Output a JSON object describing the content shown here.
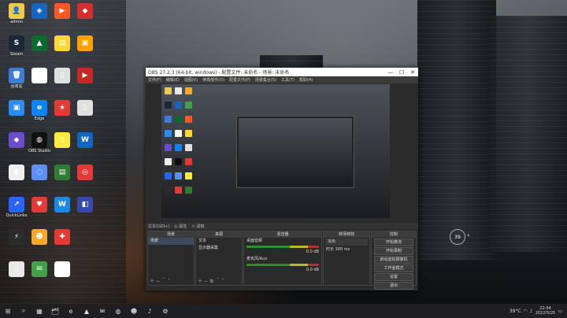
{
  "desktop": {
    "icons": [
      {
        "label": "admin",
        "color": "#f2c94c",
        "glyph": "👤"
      },
      {
        "label": "Steam",
        "color": "#1b2838",
        "glyph": "S"
      },
      {
        "label": "回收站",
        "color": "#3b7dd8",
        "glyph": "🗑"
      },
      {
        "label": "",
        "color": "#2d8cf0",
        "glyph": "▣"
      },
      {
        "label": "",
        "color": "#6a4ccf",
        "glyph": "◆"
      },
      {
        "label": "",
        "color": "#f0f0f0",
        "glyph": "▮"
      },
      {
        "label": "QuickLinks",
        "color": "#2962ff",
        "glyph": "↗"
      },
      {
        "label": "",
        "color": "#2b2b2b",
        "glyph": "⚡"
      },
      {
        "label": "",
        "color": "#e8e8e8",
        "glyph": "▯"
      },
      {
        "label": "",
        "color": "#1565c0",
        "glyph": "◈"
      },
      {
        "label": "",
        "color": "#0b6b2e",
        "glyph": "▲"
      },
      {
        "label": "",
        "color": "#fff",
        "glyph": "◉"
      },
      {
        "label": "Edge",
        "color": "#0a84ff",
        "glyph": "e"
      },
      {
        "label": "OBS Studio",
        "color": "#111",
        "glyph": "◍"
      },
      {
        "label": "",
        "color": "#5b8ff9",
        "glyph": "◌"
      },
      {
        "label": "",
        "color": "#e53935",
        "glyph": "♥"
      },
      {
        "label": "",
        "color": "#f9a825",
        "glyph": "☻"
      },
      {
        "label": "",
        "color": "#43a047",
        "glyph": "✉"
      },
      {
        "label": "",
        "color": "#ff5722",
        "glyph": "▶"
      },
      {
        "label": "",
        "color": "#fdd835",
        "glyph": "▤"
      },
      {
        "label": "",
        "color": "#e0e0e0",
        "glyph": "▯"
      },
      {
        "label": "",
        "color": "#e53935",
        "glyph": "★"
      },
      {
        "label": "",
        "color": "#ffeb3b",
        "glyph": "▯"
      },
      {
        "label": "",
        "color": "#2e7d32",
        "glyph": "▤"
      },
      {
        "label": "",
        "color": "#1e88e5",
        "glyph": "W"
      },
      {
        "label": "",
        "color": "#e53935",
        "glyph": "✚"
      },
      {
        "label": "",
        "color": "#fff",
        "glyph": "▭"
      },
      {
        "label": "",
        "color": "#d32f2f",
        "glyph": "◆"
      },
      {
        "label": "",
        "color": "#ffa000",
        "glyph": "▣"
      },
      {
        "label": "",
        "color": "#c62828",
        "glyph": "▶"
      },
      {
        "label": "",
        "color": "#e0e0e0",
        "glyph": "▯"
      },
      {
        "label": "",
        "color": "#1565c0",
        "glyph": "W"
      },
      {
        "label": "",
        "color": "#e53935",
        "glyph": "◎"
      },
      {
        "label": "",
        "color": "#3949ab",
        "glyph": "◧"
      }
    ]
  },
  "obs": {
    "title": "OBS 27.2.3 (64-bit, windows) - 配置文件: 未命名 - 场景: 未命名",
    "menu": [
      "文件(F)",
      "编辑(E)",
      "视图(V)",
      "停靠部件(D)",
      "配置文件(P)",
      "场景集合(S)",
      "工具(T)",
      "帮助(H)"
    ],
    "status_row": [
      "文本(GDI+)",
      "◎ 属性",
      "☼ 滤镜"
    ],
    "docks": {
      "scenes": {
        "title": "场景",
        "items": [
          "场景"
        ]
      },
      "sources": {
        "title": "来源",
        "items": [
          "文本",
          "显示器采集"
        ]
      },
      "mixer": {
        "title": "混音器",
        "items": [
          "桌面音频",
          "麦克风/Aux"
        ],
        "levels": [
          "0.0 dB",
          "0.0 dB"
        ]
      },
      "transitions": {
        "title": "转场特效",
        "items": [
          "淡出",
          "时长 300 ms"
        ]
      },
      "controls": {
        "title": "控制",
        "buttons": [
          "开始推流",
          "开始录制",
          "启动虚拟摄像机",
          "工作室模式",
          "设置",
          "退出"
        ]
      }
    }
  },
  "taskbar": {
    "start_glyph": "⊞",
    "search_glyph": "⌕",
    "apps": [
      "▦",
      "🗂",
      "e",
      "▲",
      "✉",
      "◍",
      "☻",
      "♪",
      "⚙"
    ],
    "tray": {
      "temp": "39°C",
      "time": "22:04",
      "date": "2022/5/25"
    }
  },
  "widget": {
    "value": "39",
    "text": "°"
  }
}
